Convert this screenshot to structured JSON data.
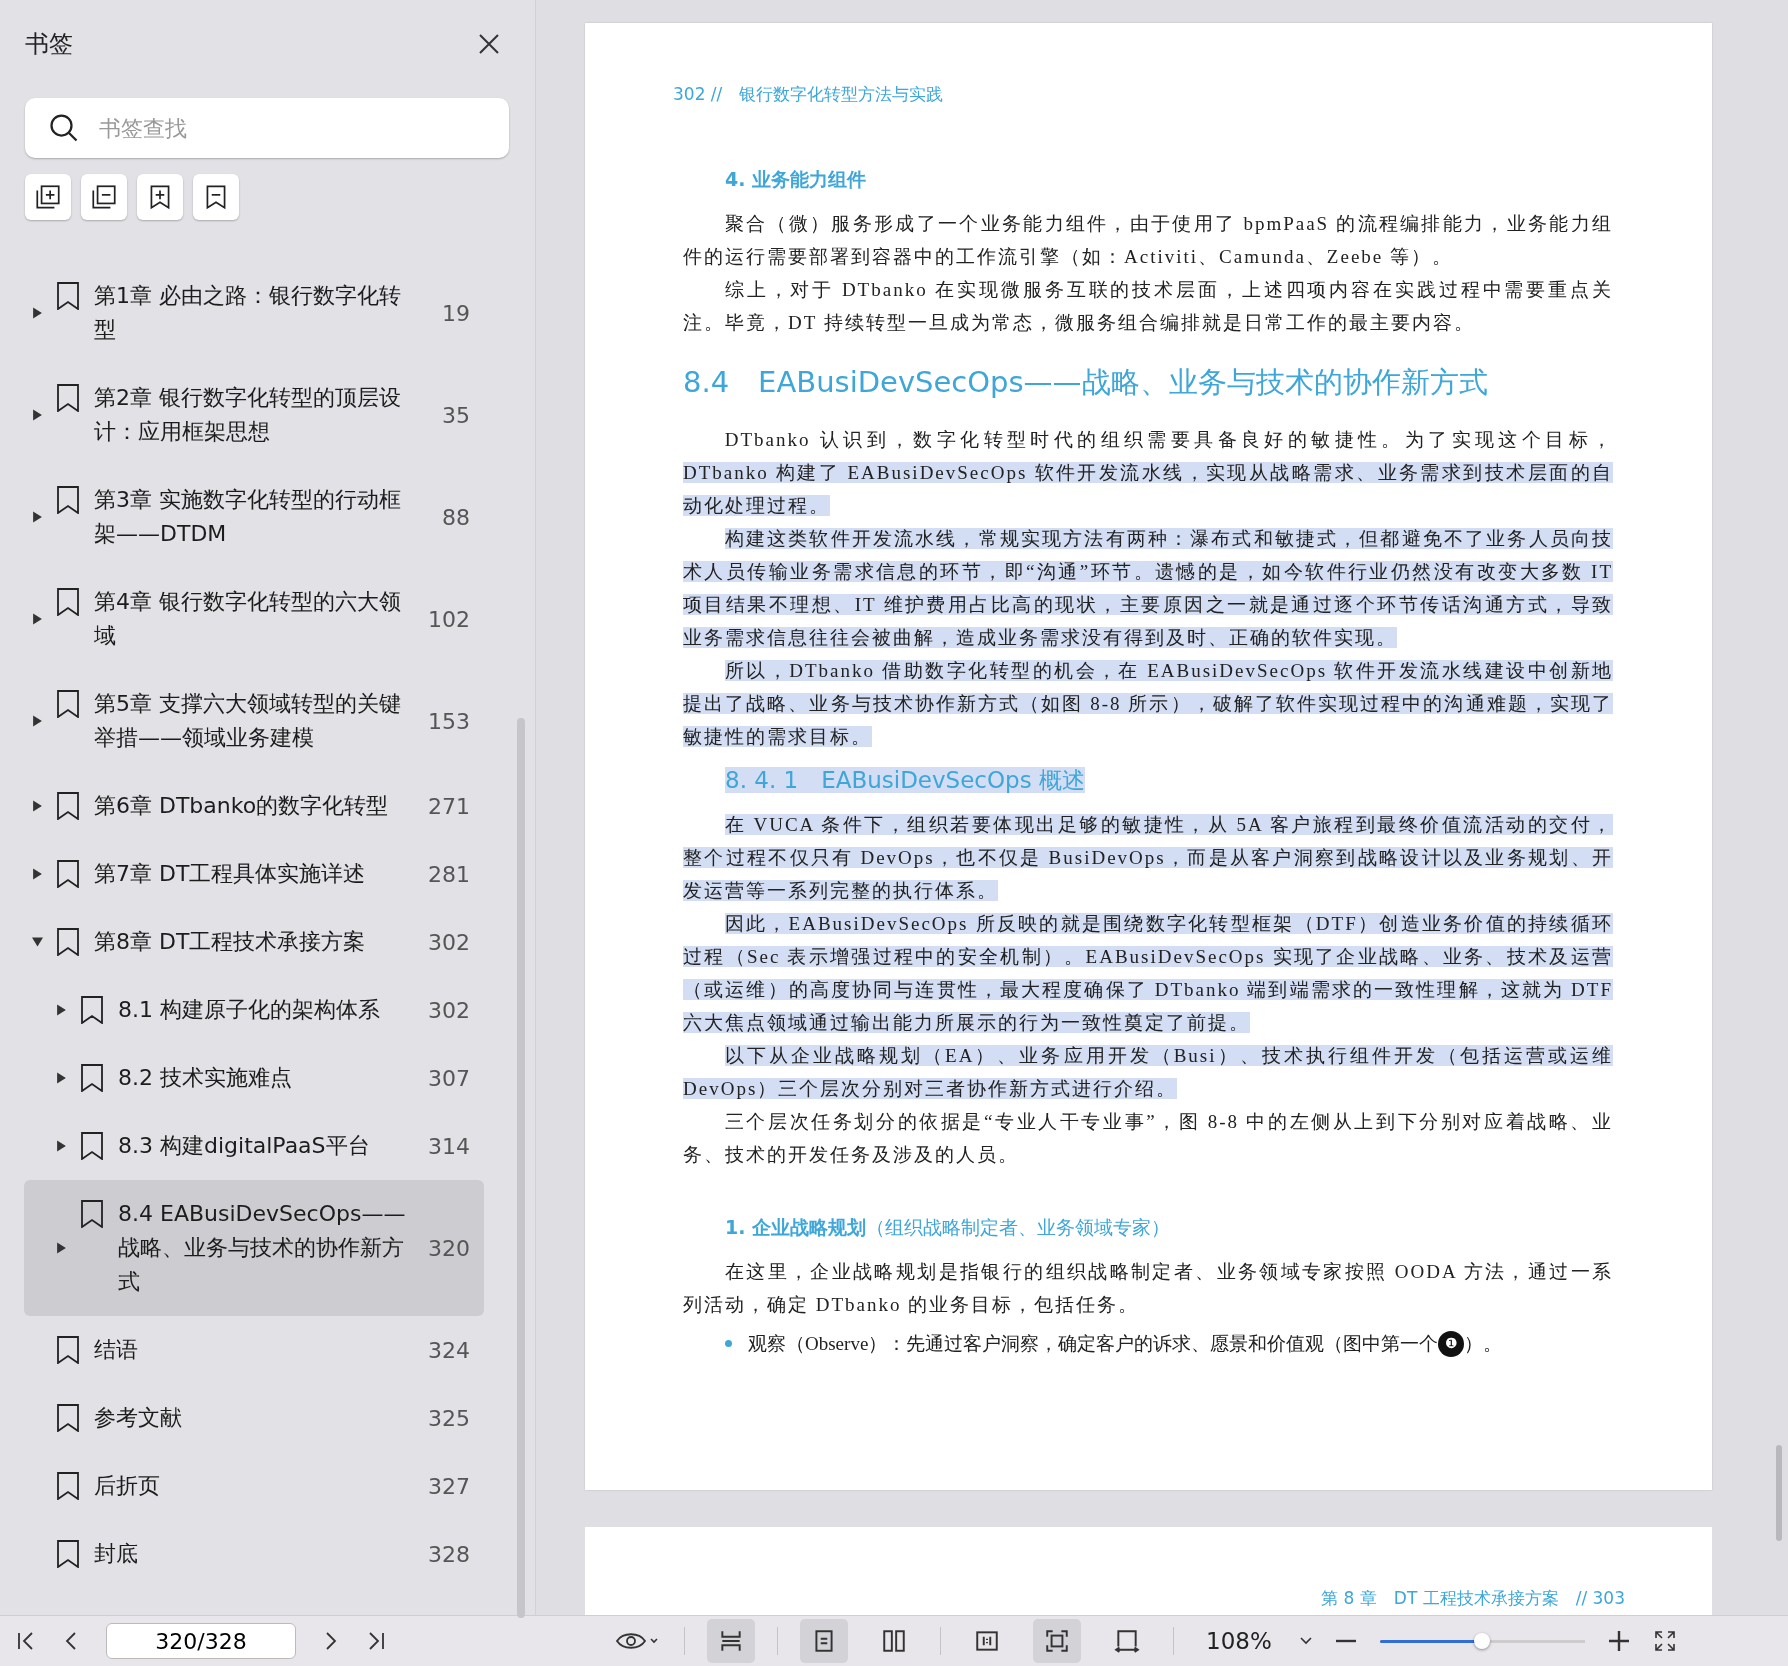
{
  "sidebar": {
    "title": "书签",
    "search": {
      "placeholder": "书签查找"
    },
    "bookmarks": [
      {
        "label": "第1章 必由之路：银行数字化转型",
        "page": "19",
        "expandable": true,
        "expanded": false,
        "selected": false
      },
      {
        "label": "第2章 银行数字化转型的顶层设计：应用框架思想",
        "page": "35",
        "expandable": true,
        "expanded": false,
        "selected": false
      },
      {
        "label": "第3章 实施数字化转型的行动框架——DTDM",
        "page": "88",
        "expandable": true,
        "expanded": false,
        "selected": false
      },
      {
        "label": "第4章 银行数字化转型的六大领域",
        "page": "102",
        "expandable": true,
        "expanded": false,
        "selected": false
      },
      {
        "label": "第5章 支撑六大领域转型的关键举措——领域业务建模",
        "page": "153",
        "expandable": true,
        "expanded": false,
        "selected": false
      },
      {
        "label": "第6章 DTbanko的数字化转型",
        "page": "271",
        "expandable": true,
        "expanded": false,
        "selected": false
      },
      {
        "label": "第7章 DT工程具体实施详述",
        "page": "281",
        "expandable": true,
        "expanded": false,
        "selected": false
      },
      {
        "label": "第8章 DT工程技术承接方案",
        "page": "302",
        "expandable": true,
        "expanded": true,
        "selected": false,
        "children": [
          {
            "label": "8.1 构建原子化的架构体系",
            "page": "302",
            "expandable": true,
            "expanded": false,
            "selected": false
          },
          {
            "label": "8.2 技术实施难点",
            "page": "307",
            "expandable": true,
            "expanded": false,
            "selected": false
          },
          {
            "label": "8.3 构建digitalPaaS平台",
            "page": "314",
            "expandable": true,
            "expanded": false,
            "selected": false
          },
          {
            "label": "8.4 EABusiDevSecOps——战略、业务与技术的协作新方式",
            "page": "320",
            "expandable": true,
            "expanded": false,
            "selected": true
          }
        ]
      },
      {
        "label": "结语",
        "page": "324",
        "selected": false
      },
      {
        "label": "参考文献",
        "page": "325",
        "selected": false
      },
      {
        "label": "后折页",
        "page": "327",
        "selected": false
      },
      {
        "label": "封底",
        "page": "328",
        "selected": false
      }
    ]
  },
  "document": {
    "page": {
      "header": "302 //　银行数字化转型方法与实践",
      "blocks": [
        {
          "kind": "subhead",
          "text": "4. 业务能力组件"
        },
        {
          "kind": "para",
          "segments": [
            {
              "text": "聚合（微）服务形成了一个业务能力组件，由于使用了 bpmPaaS 的流程编排能力，业务能力组件的运行需要部署到容器中的工作流引擎（如：Activiti、Camunda、Zeebe 等）。",
              "highlighted": false
            }
          ]
        },
        {
          "kind": "para",
          "segments": [
            {
              "text": "综上，对于 DTbanko 在实现微服务互联的技术层面，上述四项内容在实践过程中需要重点关注。毕竟，DT 持续转型一旦成为常态，微服务组合编排就是日常工作的最主要内容。",
              "highlighted": false
            }
          ]
        },
        {
          "kind": "h2",
          "text": "8.4　EABusiDevSecOps——战略、业务与技术的协作新方式",
          "highlighted": false
        },
        {
          "kind": "para",
          "segments": [
            {
              "text": "DTbanko 认识到，数字化转型时代的组织需要具备良好的敏捷性。为了实现这个目标，",
              "highlighted": false
            },
            {
              "text": "DTbanko 构建了 EABusiDevSecOps 软件开发流水线，实现从战略需求、业务需求到技术层面的自动化处理过程。",
              "highlighted": true
            }
          ]
        },
        {
          "kind": "para",
          "segments": [
            {
              "text": "构建这类软件开发流水线，常规实现方法有两种：瀑布式和敏捷式，但都避免不了业务人员向技术人员传输业务需求信息的环节，即“沟通”环节。遗憾的是，如今软件行业仍然没有改变大多数 IT 项目结果不理想、IT 维护费用占比高的现状，主要原因之一就是通过逐个环节传话沟通方式，导致业务需求信息往往会被曲解，造成业务需求没有得到及时、正确的软件实现。",
              "highlighted": true
            }
          ]
        },
        {
          "kind": "para",
          "segments": [
            {
              "text": "所以，DTbanko 借助数字化转型的机会，在 EABusiDevSecOps 软件开发流水线建设中创新地提出了战略、业务与技术协作新方式（如图 8-8 所示），破解了软件实现过程中的沟通难题，实现了敏捷性的需求目标。",
              "highlighted": true
            }
          ]
        },
        {
          "kind": "h3",
          "text": "8. 4. 1　EABusiDevSecOps 概述",
          "highlighted": true
        },
        {
          "kind": "para",
          "segments": [
            {
              "text": "在 VUCA 条件下，组织若要体现出足够的敏捷性，从 5A 客户旅程到最终价值流活动的交付，整个过程不仅只有 DevOps，也不仅是 BusiDevOps，而是从客户洞察到战略设计以及业务规划、开发运营等一系列完整的执行体系。",
              "highlighted": true
            }
          ]
        },
        {
          "kind": "para",
          "segments": [
            {
              "text": "因此，EABusiDevSecOps 所反映的就是围绕数字化转型框架（DTF）创造业务价值的持续循环过程（Sec 表示增强过程中的安全机制）。EABusiDevSecOps 实现了企业战略、业务、技术及运营（或运维）的高度协同与连贯性，最大程度确保了 DTbanko 端到端需求的一致性理解，这就为 DTF 六大焦点领域通过输出能力所展示的行为一致性奠定了前提。",
              "highlighted": true
            }
          ]
        },
        {
          "kind": "para",
          "segments": [
            {
              "text": "以下从企业战略规划（EA）、业务应用开发（Busi）、技术执行组件开发（包括运营或运维 DevOps）三个层次分别对三者协作新方式进行介绍。",
              "highlighted": true
            }
          ]
        },
        {
          "kind": "para",
          "segments": [
            {
              "text": "三个层次任务划分的依据是“专业人干专业事”，图 8-8 中的左侧从上到下分别对应着战略、业务、技术的开发任务及涉及的人员。",
              "highlighted": false
            }
          ]
        },
        {
          "kind": "subhead",
          "text": "1. 企业战略规划",
          "note": "（组织战略制定者、业务领域专家）"
        },
        {
          "kind": "para",
          "segments": [
            {
              "text": "在这里，企业战略规划是指银行的组织战略制定者、业务领域专家按照 OODA 方法，通过一系列活动，确定 DTbanko 的业务目标，包括任务。",
              "highlighted": false
            }
          ]
        },
        {
          "kind": "bullet",
          "text": "观察（Observe）：先通过客户洞察，确定客户的诉求、愿景和价值观（图中第一个",
          "badge": "❶",
          "tail": "）。"
        }
      ]
    },
    "next_page": {
      "header": "第 8 章　DT 工程技术承接方案　// 303"
    }
  },
  "toolbar": {
    "page_field": "320/328",
    "view_buttons": [
      {
        "selected": true
      },
      {
        "selected": true
      },
      {
        "selected": false
      },
      {
        "selected": false
      },
      {
        "selected": true
      },
      {
        "selected": false
      }
    ],
    "zoom": "108%",
    "zoom_slider": {
      "level": 0.5
    }
  }
}
